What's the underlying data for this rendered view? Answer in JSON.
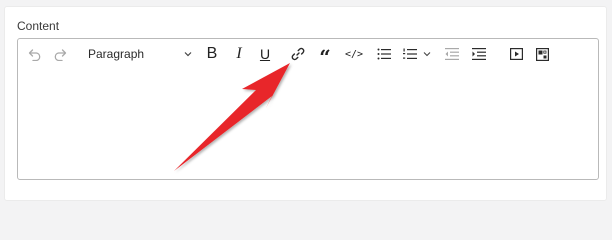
{
  "field": {
    "label": "Content"
  },
  "toolbar": {
    "format_value": "Paragraph",
    "bold": "B",
    "italic": "I",
    "underline": "U",
    "quote": "“",
    "code": "</>"
  },
  "editor": {
    "content": ""
  },
  "colors": {
    "annotation_arrow": "#e8262a",
    "border": "#b9b9b9"
  }
}
